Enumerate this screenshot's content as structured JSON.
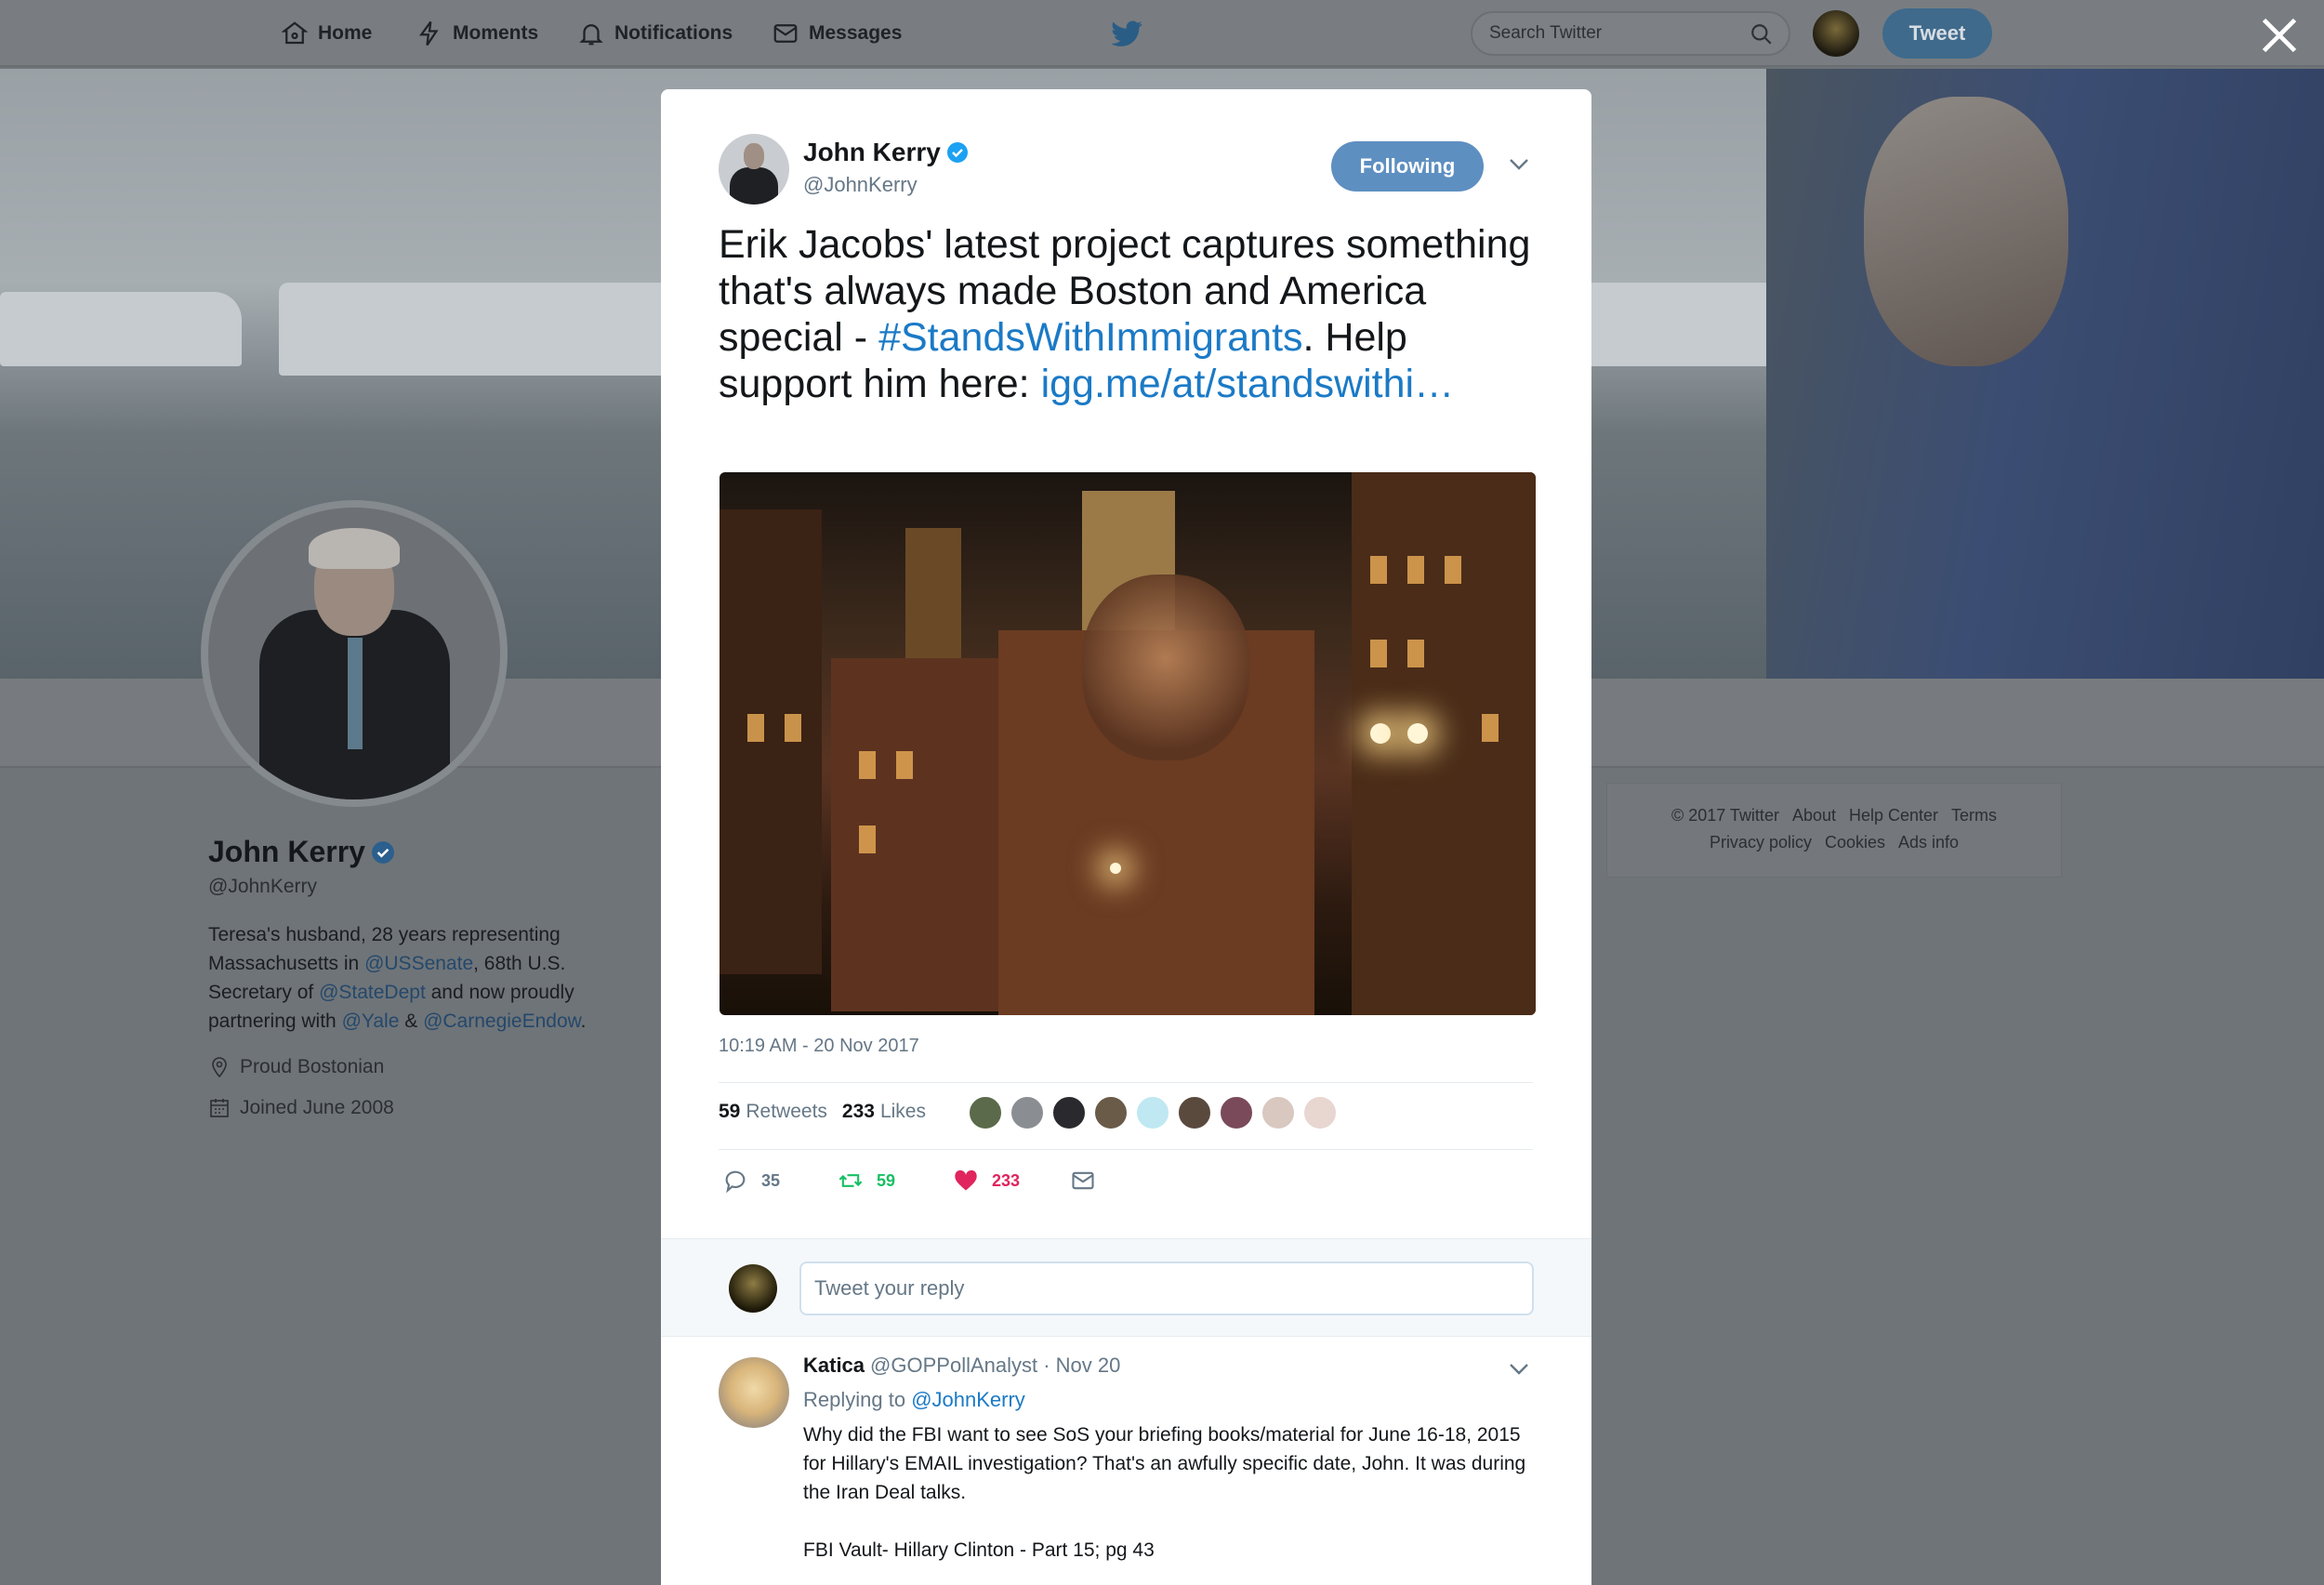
{
  "nav": {
    "home": "Home",
    "moments": "Moments",
    "notifications": "Notifications",
    "messages": "Messages",
    "search_placeholder": "Search Twitter",
    "tweet_button": "Tweet"
  },
  "profile": {
    "name": "John Kerry",
    "handle": "@JohnKerry",
    "bio_1": "Teresa's husband, 28 years representing Massachusetts in ",
    "bio_link_1": "@USSenate",
    "bio_2": ", 68th U.S. Secretary of ",
    "bio_link_2": "@StateDept",
    "bio_3": " and now proudly partnering with ",
    "bio_link_3": "@Yale",
    "bio_4": " & ",
    "bio_link_4": "@CarnegieEndow",
    "bio_5": ".",
    "location": "Proud Bostonian",
    "joined": "Joined June 2008"
  },
  "footer": {
    "copyright": "© 2017 Twitter",
    "about": "About",
    "help": "Help Center",
    "terms": "Terms",
    "privacy": "Privacy policy",
    "cookies": "Cookies",
    "ads": "Ads info"
  },
  "tweet": {
    "name": "John Kerry",
    "handle": "@JohnKerry",
    "follow_label": "Following",
    "text_1": "Erik Jacobs' latest project captures something that's always made Boston and America special - ",
    "hashtag": "#StandsWithImmigrants",
    "text_2": ". Help support him here: ",
    "link": "igg.me/at/standswithi…",
    "timestamp": "10:19 AM - 20 Nov 2017",
    "retweets_count": "59",
    "retweets_label": "Retweets",
    "likes_count": "233",
    "likes_label": "Likes",
    "reply_count": "35",
    "retweet_count": "59",
    "like_count": "233"
  },
  "reply_box": {
    "placeholder": "Tweet your reply"
  },
  "reply": {
    "name": "Katica",
    "handle": "@GOPPollAnalyst",
    "date": "· Nov 20",
    "replying_prefix": "Replying to ",
    "replying_to": "@JohnKerry",
    "text_1": "Why did the FBI want to see SoS your briefing books/material for June 16-18, 2015 for Hillary's EMAIL investigation?  That's an awfully specific date, John. It was during the Iran Deal talks.",
    "text_2": "FBI Vault- Hillary Clinton - Part 15; pg 43"
  },
  "colors": {
    "link_blue": "#1b7ac6",
    "retweet_green": "#17bf63",
    "like_red": "#e0245e",
    "verified_blue": "#1da1f2"
  }
}
